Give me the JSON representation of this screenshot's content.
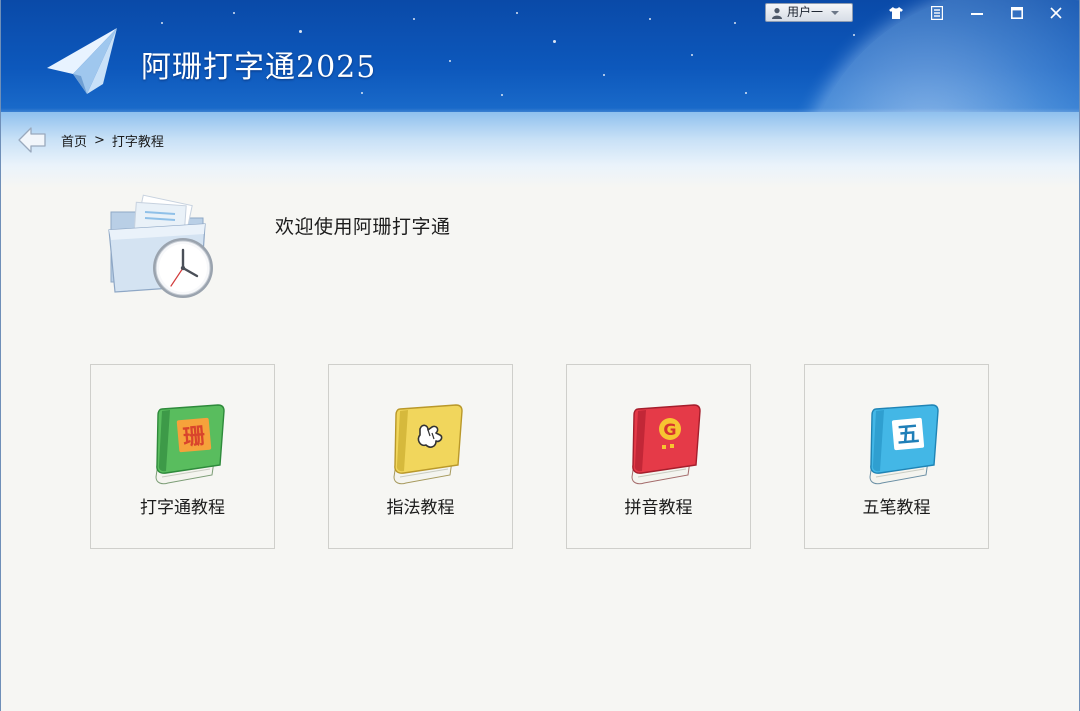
{
  "app": {
    "title": "阿珊打字通2025"
  },
  "titlebar": {
    "user_label": "用户一",
    "controls": [
      "skin-icon",
      "feedback-icon",
      "minimize-icon",
      "maximize-icon",
      "close-icon"
    ]
  },
  "breadcrumb": {
    "home": "首页",
    "separator": ">",
    "current": "打字教程"
  },
  "main": {
    "welcome": "欢迎使用阿珊打字通",
    "cards": [
      {
        "label": "打字通教程",
        "icon": "green-book-icon",
        "book_glyph": "珊",
        "color": "#5cc163"
      },
      {
        "label": "指法教程",
        "icon": "yellow-book-icon",
        "book_glyph": "hand",
        "color": "#f0d35a"
      },
      {
        "label": "拼音教程",
        "icon": "red-book-icon",
        "book_glyph": "G",
        "color": "#e8394a"
      },
      {
        "label": "五笔教程",
        "icon": "blue-book-icon",
        "book_glyph": "五",
        "color": "#41b5e4"
      }
    ]
  },
  "colors": {
    "header_blue": "#0d58bc",
    "content_bg": "#f6f6f3",
    "card_border": "#cfcfcb"
  }
}
